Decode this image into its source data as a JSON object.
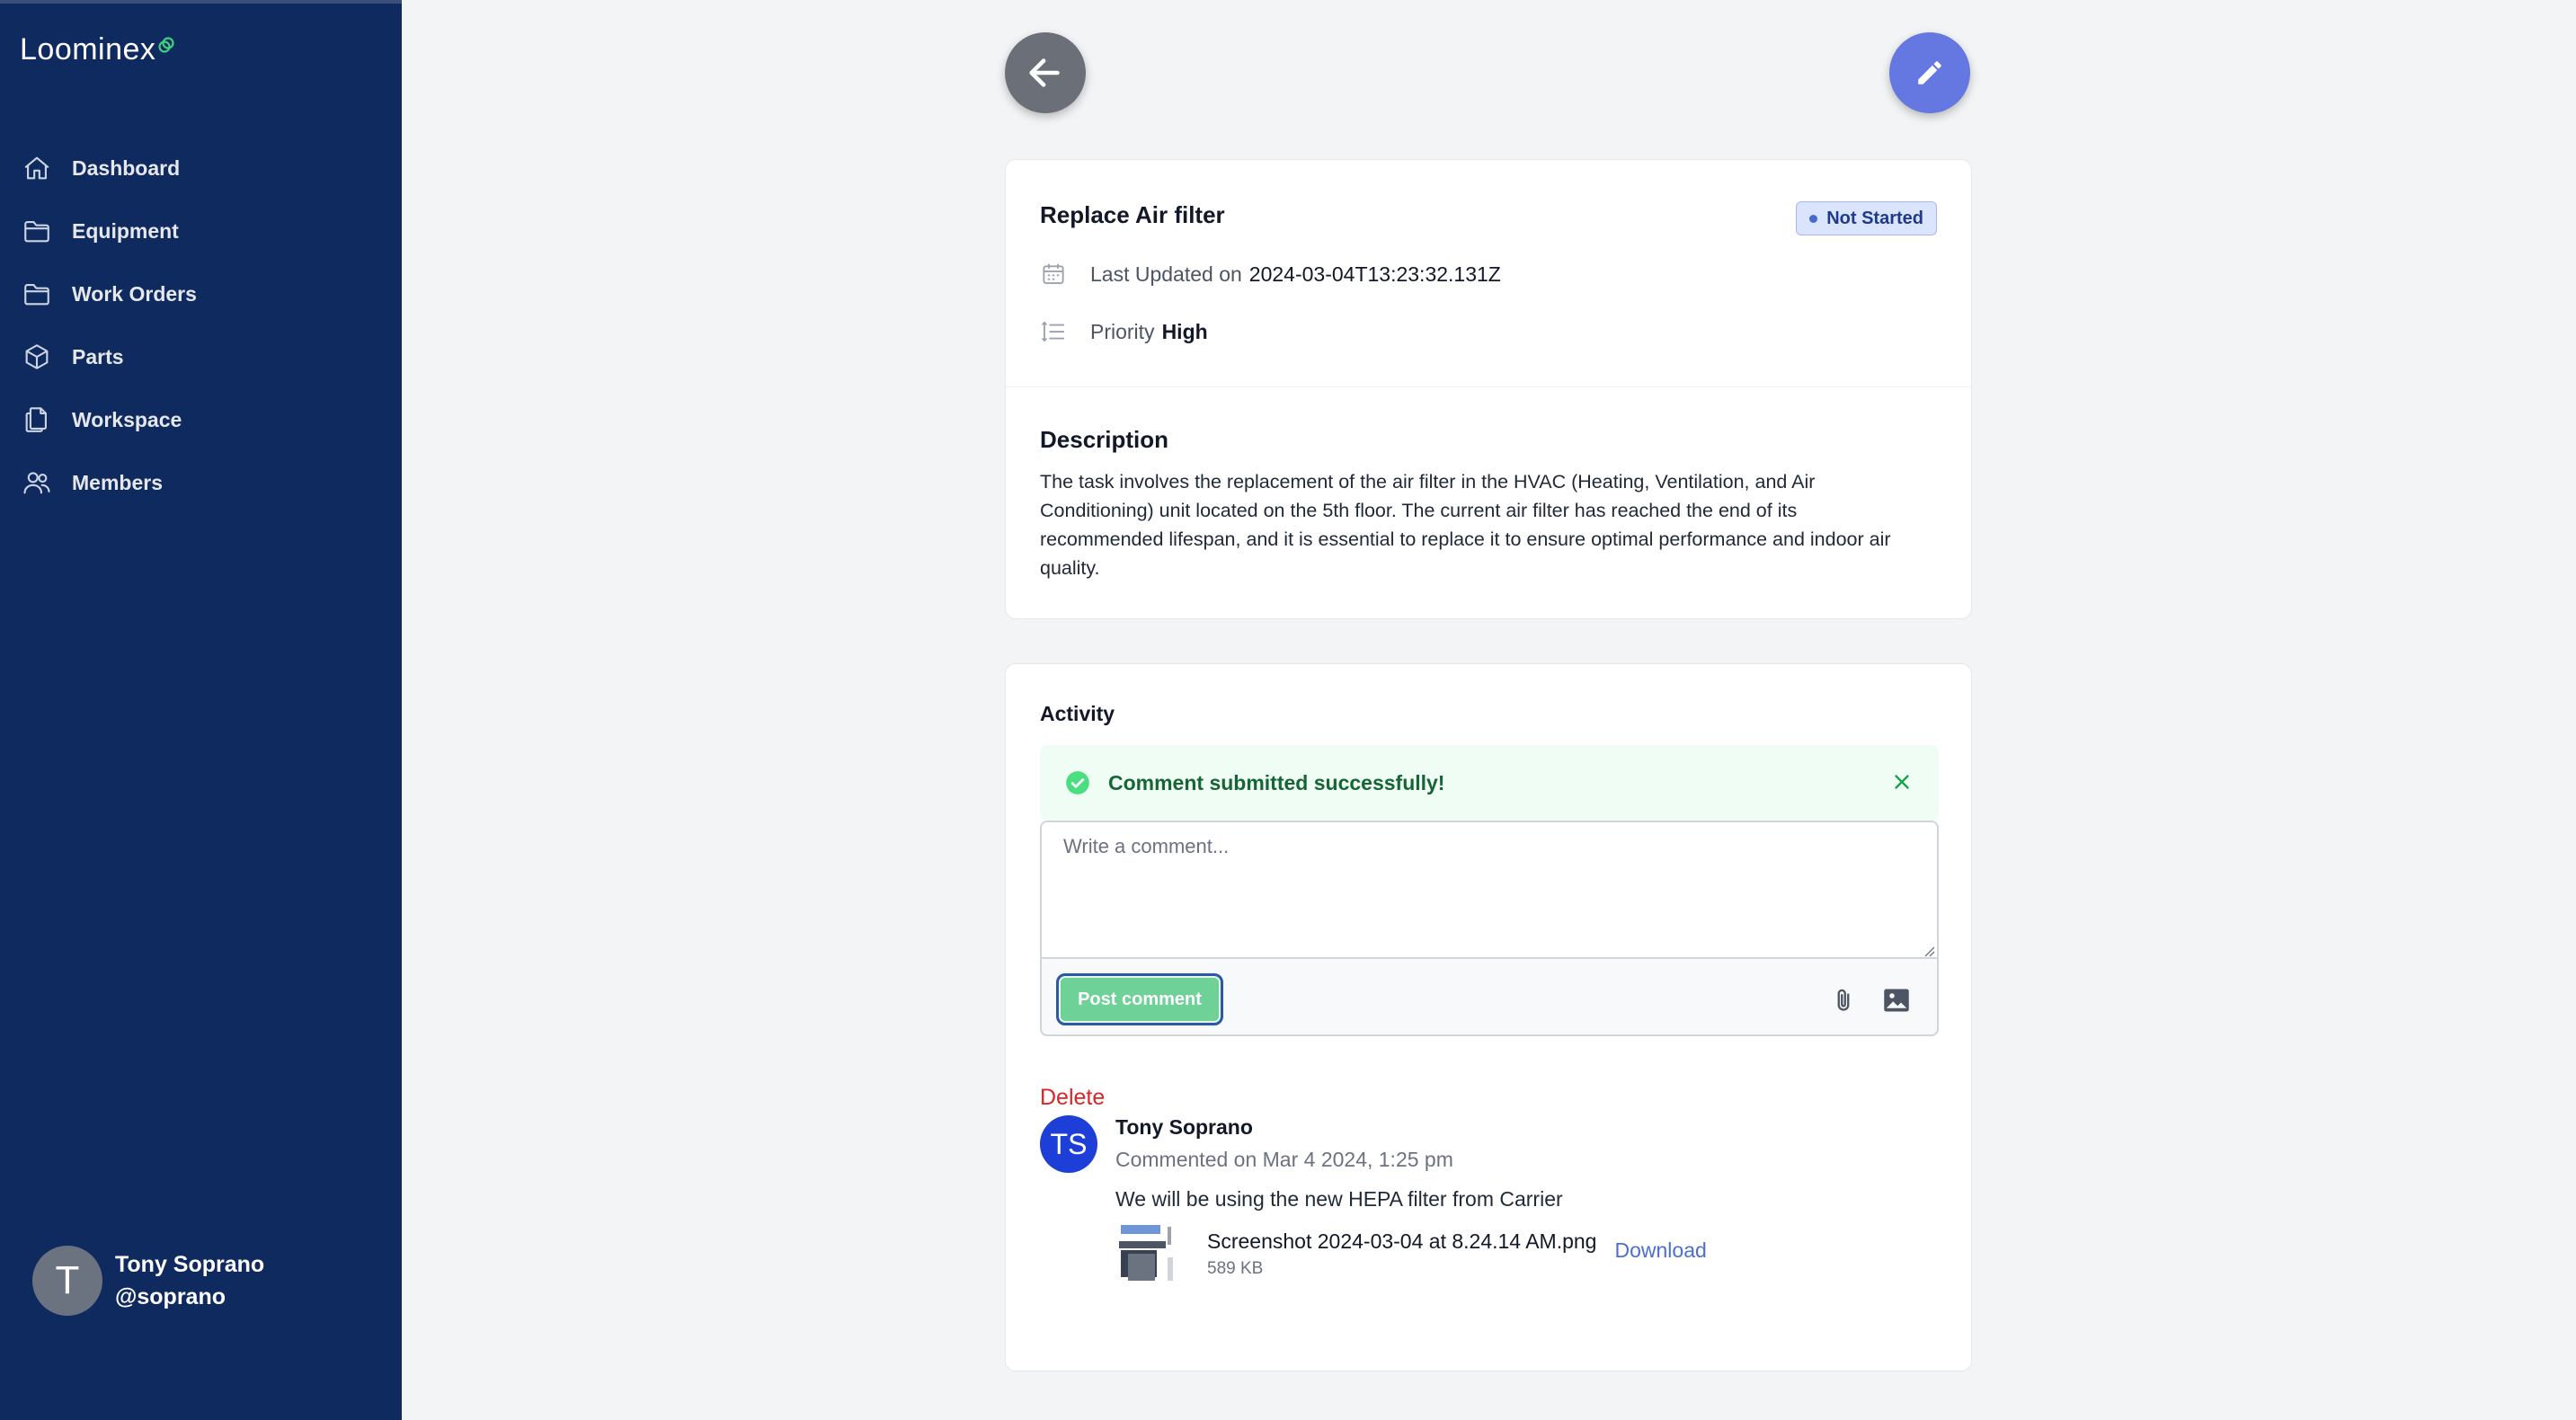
{
  "app": {
    "logo_text": "Loominex",
    "brand_accent": "#3fcf7f",
    "sidebar_bg": "#0f2a5f"
  },
  "sidebar": {
    "items": [
      {
        "label": "Dashboard",
        "icon": "home-icon"
      },
      {
        "label": "Equipment",
        "icon": "folder-icon"
      },
      {
        "label": "Work Orders",
        "icon": "folder-icon"
      },
      {
        "label": "Parts",
        "icon": "cube-icon"
      },
      {
        "label": "Workspace",
        "icon": "documents-icon"
      },
      {
        "label": "Members",
        "icon": "users-icon"
      }
    ],
    "user": {
      "initial": "T",
      "name": "Tony Soprano",
      "handle": "@soprano"
    }
  },
  "header": {
    "back_icon": "arrow-left-icon",
    "edit_icon": "pencil-icon"
  },
  "task": {
    "title": "Replace Air filter",
    "status": "Not Started",
    "updated_label": "Last Updated on",
    "updated_value": "2024-03-04T13:23:32.131Z",
    "priority_label": "Priority",
    "priority_value": "High",
    "description_title": "Description",
    "description": "The task involves the replacement of the air filter in the HVAC (Heating, Ventilation, and Air Conditioning) unit located on the 5th floor. The current air filter has reached the end of its recommended lifespan, and it is essential to replace it to ensure optimal performance and indoor air quality."
  },
  "activity": {
    "title": "Activity",
    "alert_text": "Comment submitted successfully!",
    "comment_placeholder": "Write a comment...",
    "comment_value": "",
    "post_label": "Post comment",
    "comments": [
      {
        "delete_label": "Delete",
        "initials": "TS",
        "author": "Tony Soprano",
        "date": "Commented on Mar 4 2024, 1:25 pm",
        "body": "We will be using the new HEPA filter from Carrier",
        "attachment": {
          "name": "Screenshot 2024-03-04 at 8.24.14 AM.png",
          "size": "589 KB",
          "download_label": "Download"
        }
      }
    ]
  }
}
